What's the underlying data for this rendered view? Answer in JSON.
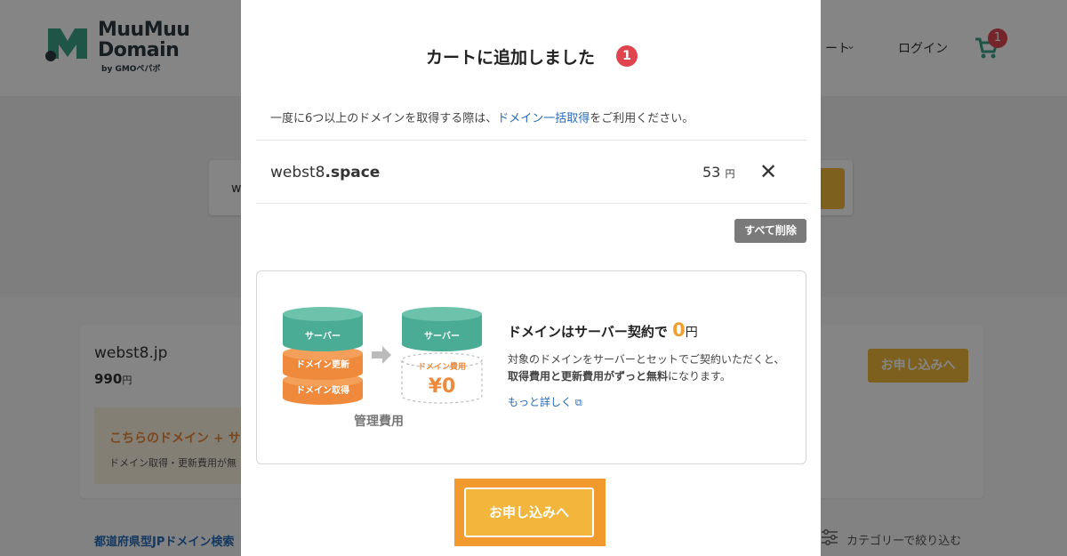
{
  "header": {
    "logo_line1": "MuuMuu",
    "logo_line2": "Domain",
    "logo_sub": "by GMOペパボ",
    "support_partial": "ート",
    "login": "ログイン",
    "cart_count": "1"
  },
  "search": {
    "partial_text": "w"
  },
  "result": {
    "domain": "webst8.jp",
    "price": "990",
    "yen": "円",
    "promo_title": "こちらのドメイン + サー",
    "promo_sub": "ドメイン取得・更新費用が無",
    "apply": "お申し込みへ"
  },
  "footer_links": {
    "prefecture": "都道府県型JPドメイン検索",
    "filter": "カテゴリーで絞り込む"
  },
  "modal": {
    "title": "カートに追加しました",
    "count": "1",
    "notice_before": "一度に6つ以上のドメインを取得する際は、",
    "notice_link": "ドメイン一括取得",
    "notice_after": "をご利用ください。",
    "cart_item": {
      "name": "webst8",
      "tld": ".space",
      "price": "53",
      "yen": "円"
    },
    "delete_all": "すべて削除",
    "promo": {
      "cyl_server": "サーバー",
      "cyl_renew": "ドメイン更新",
      "cyl_acquire": "ドメイン取得",
      "cyl_fee": "ドメイン費用",
      "cyl_zero": "¥0",
      "mgmt": "管理費用",
      "headline_before": "ドメインはサーバー契約で",
      "headline_zero": "0",
      "headline_yen": "円",
      "desc1": "対象のドメインをサーバーとセットでご契約いただくと、",
      "desc2_bold": "取得費用と更新費用がずっと無料",
      "desc2_rest": "になります。",
      "more": "もっと詳しく"
    },
    "apply": "お申し込みへ"
  },
  "colors": {
    "accent": "#f2b63c",
    "teal": "#4aac95",
    "orange": "#f29a2e",
    "badge": "#e0454f",
    "link": "#2a6bb8"
  }
}
